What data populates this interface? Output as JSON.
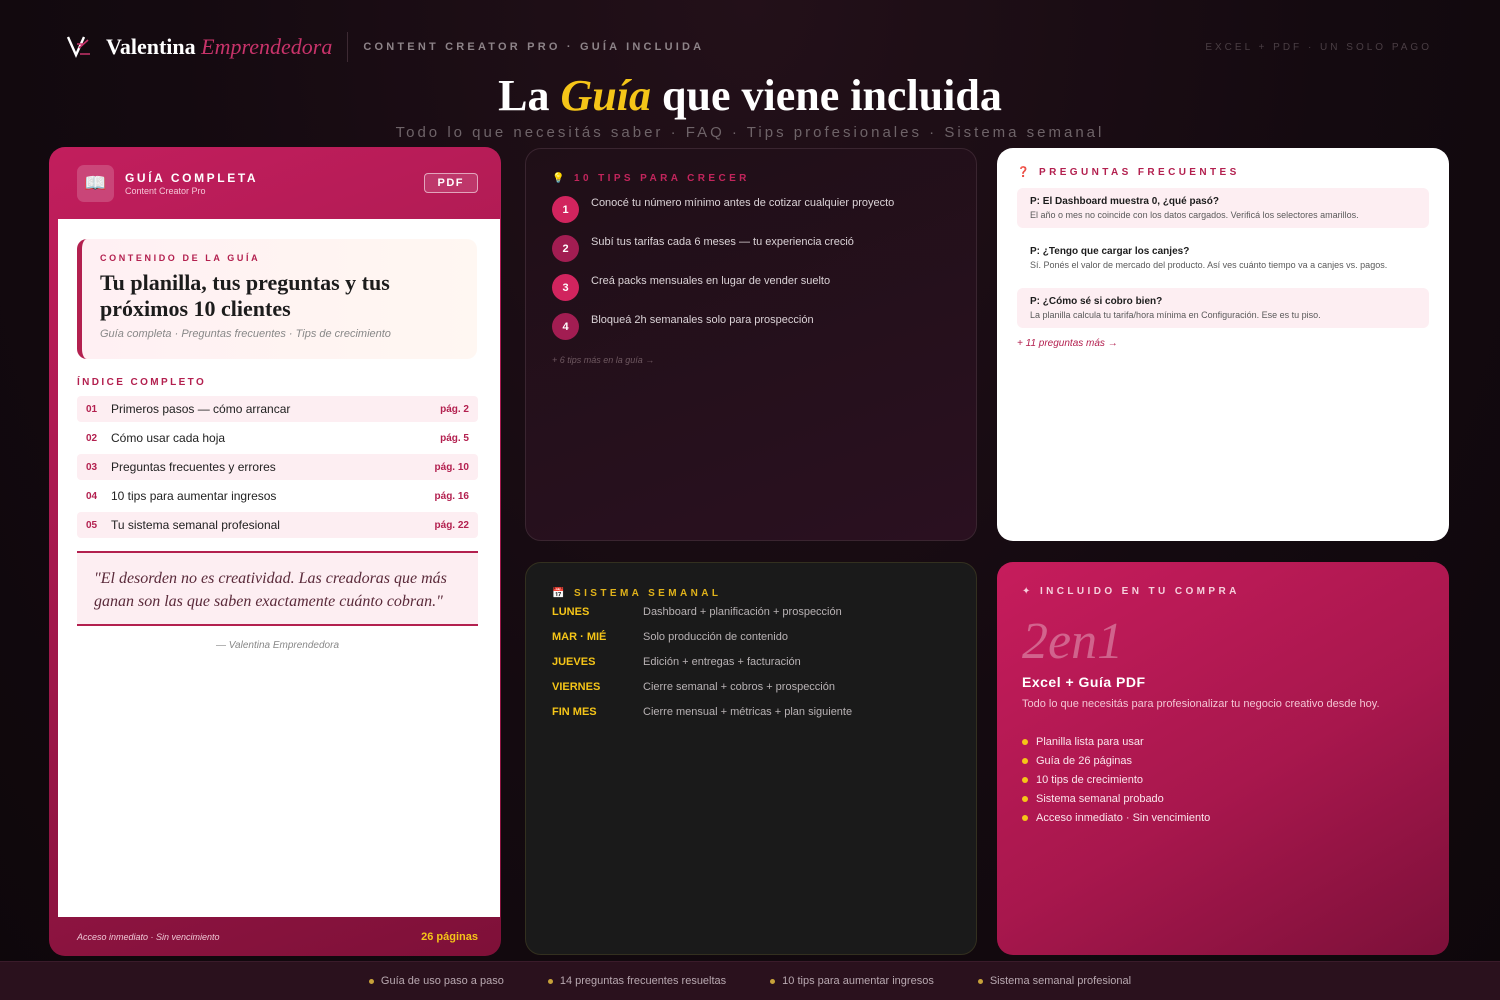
{
  "header": {
    "brand_name": "Valentina",
    "brand_accent": "Emprendedora",
    "tagline": "CONTENT CREATOR PRO · GUÍA INCLUIDA",
    "right_tag": "EXCEL + PDF · UN SOLO PAGO"
  },
  "hero": {
    "title_a": "La",
    "title_highlight": "Guía",
    "title_b": "que viene incluida",
    "subtitle": "Todo lo que necesitás saber · FAQ · Tips profesionales · Sistema semanal"
  },
  "guide": {
    "icon": "book-icon",
    "title": "GUÍA COMPLETA",
    "subtitle": "Content Creator Pro",
    "badge": "PDF",
    "content_label": "CONTENIDO DE LA GUÍA",
    "content_title": "Tu planilla, tus preguntas y tus próximos 10 clientes",
    "content_sub": "Guía completa · Preguntas frecuentes · Tips de crecimiento",
    "index_label": "ÍNDICE COMPLETO",
    "index": [
      {
        "num": "01",
        "text": "Primeros pasos — cómo arrancar",
        "page": "pág. 2"
      },
      {
        "num": "02",
        "text": "Cómo usar cada hoja",
        "page": "pág. 5"
      },
      {
        "num": "03",
        "text": "Preguntas frecuentes y errores",
        "page": "pág. 10"
      },
      {
        "num": "04",
        "text": "10 tips para aumentar ingresos",
        "page": "pág. 16"
      },
      {
        "num": "05",
        "text": "Tu sistema semanal profesional",
        "page": "pág. 22"
      }
    ],
    "quote": "\"El desorden no es creatividad. Las creadoras que más ganan son las que saben exactamente cuánto cobran.\"",
    "quote_author": "— Valentina Emprendedora",
    "footer_left": "Acceso inmediato · Sin vencimiento",
    "footer_right": "26 páginas"
  },
  "tips": {
    "icon": "lightbulb-icon",
    "label": "10 TIPS PARA CRECER",
    "items": [
      {
        "num": "1",
        "text": "Conocé tu número mínimo antes de cotizar cualquier proyecto"
      },
      {
        "num": "2",
        "text": "Subí tus tarifas cada 6 meses — tu experiencia creció"
      },
      {
        "num": "3",
        "text": "Creá packs mensuales en lugar de vender suelto"
      },
      {
        "num": "4",
        "text": "Bloqueá 2h semanales solo para prospección"
      }
    ],
    "more": "+ 6 tips más en la guía →"
  },
  "faq": {
    "icon": "question-icon",
    "label": "PREGUNTAS FRECUENTES",
    "items": [
      {
        "q": "P: El Dashboard muestra 0, ¿qué pasó?",
        "a": "El año o mes no coincide con los datos cargados. Verificá los selectores amarillos."
      },
      {
        "q": "P: ¿Tengo que cargar los canjes?",
        "a": "Sí. Ponés el valor de mercado del producto. Así ves cuánto tiempo va a canjes vs. pagos."
      },
      {
        "q": "P: ¿Cómo sé si cobro bien?",
        "a": "La planilla calcula tu tarifa/hora mínima en Configuración. Ese es tu piso."
      }
    ],
    "more": "+ 11 preguntas más →"
  },
  "weekly": {
    "icon": "calendar-icon",
    "label": "SISTEMA SEMANAL",
    "rows": [
      {
        "day": "LUNES",
        "task": "Dashboard + planificación + prospección"
      },
      {
        "day": "MAR · MIÉ",
        "task": "Solo producción de contenido"
      },
      {
        "day": "JUEVES",
        "task": "Edición + entregas + facturación"
      },
      {
        "day": "VIERNES",
        "task": "Cierre semanal + cobros + prospección"
      },
      {
        "day": "FIN MES",
        "task": "Cierre mensual + métricas + plan siguiente"
      }
    ]
  },
  "included": {
    "icon": "sparkle-icon",
    "label": "INCLUIDO EN TU COMPRA",
    "big": "2en1",
    "title": "Excel + Guía PDF",
    "desc": "Todo lo que necesitás para profesionalizar tu negocio creativo desde hoy.",
    "items": [
      "Planilla lista para usar",
      "Guía de 26 páginas",
      "10 tips de crecimiento",
      "Sistema semanal probado",
      "Acceso inmediato · Sin vencimiento"
    ]
  },
  "bottom_bar": [
    "Guía de uso paso a paso",
    "14 preguntas frecuentes resueltas",
    "10 tips para aumentar ingresos",
    "Sistema semanal profesional"
  ],
  "colors": {
    "accent": "#c2255c",
    "gold": "#f5c518",
    "background": "#140a10"
  }
}
